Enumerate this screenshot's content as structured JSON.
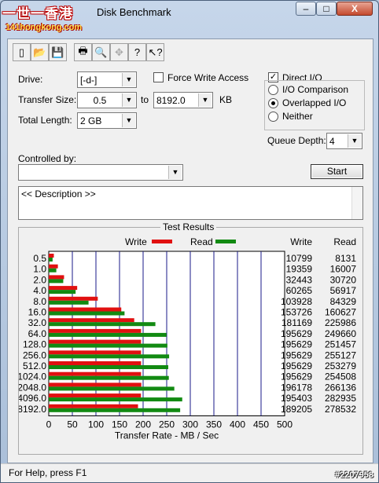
{
  "window": {
    "title": "Disk Benchmark",
    "logo_cn": "一世一香港",
    "logo_site": "141hongkong.com",
    "controls": [
      "–",
      "□",
      "X"
    ]
  },
  "toolbar": {
    "buttons": [
      {
        "name": "new-icon",
        "glyph": "▯"
      },
      {
        "name": "open-folder-icon",
        "glyph": "📂"
      },
      {
        "name": "save-icon",
        "glyph": "💾"
      },
      {
        "name": "print-icon",
        "glyph": "🖶"
      },
      {
        "name": "print-preview-icon",
        "glyph": "🔍"
      },
      {
        "name": "move-icon",
        "glyph": "✥"
      },
      {
        "name": "help-icon",
        "glyph": "?"
      },
      {
        "name": "context-help-icon",
        "glyph": "↖?"
      }
    ]
  },
  "form": {
    "drive_label": "Drive:",
    "drive_value": "[-d-]",
    "force_write_label": "Force Write Access",
    "direct_io_label": "Direct I/O",
    "direct_io_checked": true,
    "transfer_size_label": "Transfer Size:",
    "transfer_from": "0.5",
    "to_label": "to",
    "transfer_to": "8192.0",
    "kb_label": "KB",
    "total_length_label": "Total Length:",
    "total_length_value": "2 GB",
    "io_options": [
      "I/O Comparison",
      "Overlapped I/O",
      "Neither"
    ],
    "io_selected": "Overlapped I/O",
    "queue_depth_label": "Queue Depth:",
    "queue_depth_value": "4",
    "controlled_by_label": "Controlled by:",
    "controlled_by_value": "",
    "start_label": "Start",
    "description": "<< Description >>"
  },
  "results": {
    "title": "Test Results",
    "write_color": "#e11010",
    "read_color": "#128a12",
    "chart_data": {
      "type": "bar",
      "orientation": "horizontal",
      "categories": [
        "0.5",
        "1.0",
        "2.0",
        "4.0",
        "8.0",
        "16.0",
        "32.0",
        "64.0",
        "128.0",
        "256.0",
        "512.0",
        "1024.0",
        "2048.0",
        "4096.0",
        "8192.0"
      ],
      "series": [
        {
          "name": "Write",
          "values": [
            10799,
            19359,
            32443,
            60265,
            103928,
            153726,
            181169,
            195629,
            195629,
            195629,
            195629,
            195629,
            196178,
            195403,
            189205
          ]
        },
        {
          "name": "Read",
          "values": [
            8131,
            16007,
            30720,
            56917,
            84329,
            160627,
            225986,
            249660,
            251457,
            255127,
            253279,
            254508,
            266136,
            282935,
            278532
          ]
        }
      ],
      "bar_scale": 0.001,
      "xlabel": "Transfer Rate - MB / Sec",
      "xlim": [
        0,
        500
      ],
      "xticks": [
        "0",
        "50",
        "100",
        "150",
        "200",
        "250",
        "300",
        "350",
        "400",
        "450",
        "500"
      ],
      "col_headers": [
        "Write",
        "Read"
      ]
    }
  },
  "status": {
    "text": "For Help, press F1",
    "watermark": "#2207958"
  }
}
